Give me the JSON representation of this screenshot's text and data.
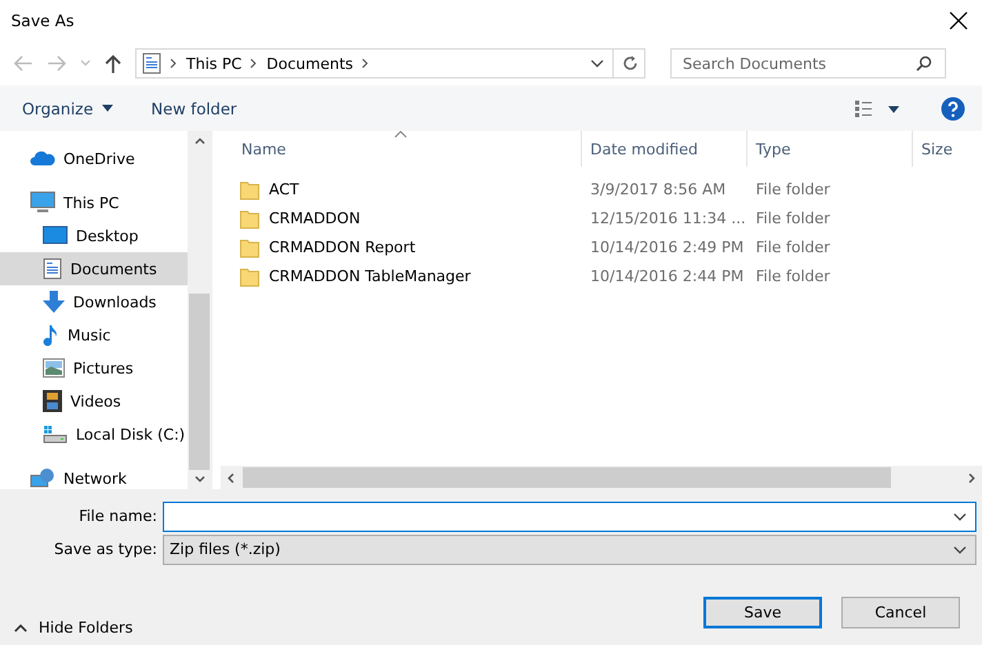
{
  "window": {
    "title": "Save As"
  },
  "address": {
    "crumbs": [
      "This PC",
      "Documents"
    ]
  },
  "search": {
    "placeholder": "Search Documents"
  },
  "toolbar": {
    "organize": "Organize",
    "new_folder": "New folder"
  },
  "sidebar": {
    "items": [
      {
        "label": "OneDrive",
        "kind": "cloud",
        "selected": false
      },
      {
        "label": "This PC",
        "kind": "computer",
        "selected": false,
        "children": [
          {
            "label": "Desktop",
            "kind": "desktop",
            "selected": false
          },
          {
            "label": "Documents",
            "kind": "document",
            "selected": true
          },
          {
            "label": "Downloads",
            "kind": "download",
            "selected": false
          },
          {
            "label": "Music",
            "kind": "music",
            "selected": false
          },
          {
            "label": "Pictures",
            "kind": "picture",
            "selected": false
          },
          {
            "label": "Videos",
            "kind": "video",
            "selected": false
          },
          {
            "label": "Local Disk (C:)",
            "kind": "disk",
            "selected": false
          }
        ]
      },
      {
        "label": "Network",
        "kind": "network",
        "selected": false
      }
    ]
  },
  "table": {
    "columns": [
      "Name",
      "Date modified",
      "Type",
      "Size"
    ],
    "rows": [
      {
        "name": "ACT",
        "date": "3/9/2017 8:56 AM",
        "type": "File folder"
      },
      {
        "name": "CRMADDON",
        "date": "12/15/2016 11:34 ...",
        "type": "File folder"
      },
      {
        "name": "CRMADDON Report",
        "date": "10/14/2016 2:49 PM",
        "type": "File folder"
      },
      {
        "name": "CRMADDON TableManager",
        "date": "10/14/2016 2:44 PM",
        "type": "File folder"
      }
    ]
  },
  "form": {
    "file_name_label": "File name:",
    "save_type_label": "Save as type:",
    "save_type": "Zip files (*.zip)"
  },
  "hide_folders": "Hide Folders",
  "buttons": {
    "save": "Save",
    "cancel": "Cancel"
  }
}
